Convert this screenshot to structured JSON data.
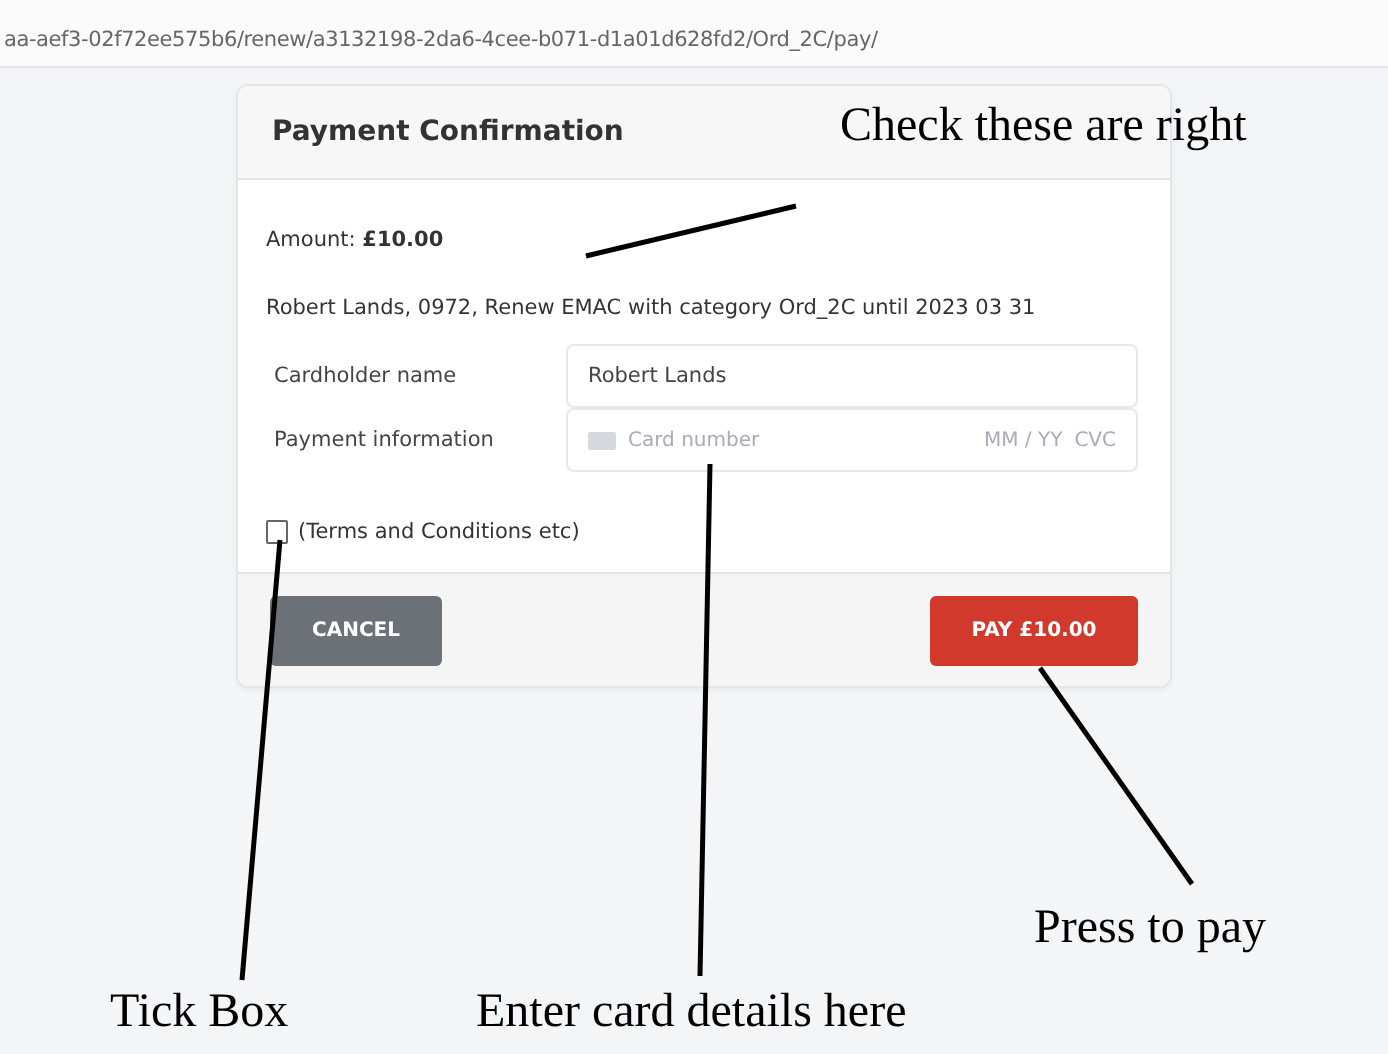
{
  "address_bar": {
    "url": "aa-aef3-02f72ee575b6/renew/a3132198-2da6-4cee-b071-d1a01d628fd2/Ord_2C/pay/"
  },
  "dialog": {
    "title": "Payment Confirmation",
    "amount": "Amount: **£10.00**",
    "description": "Robert Lands, 0972, Renew EMAC with category Ord_2C until 2023 03 31",
    "cardholder": {
      "label": "Cardholder name",
      "value": "Robert Lands"
    },
    "payment": {
      "label": "Payment information",
      "placeholder": "Card number",
      "expiry_placeholder": "MM / YY",
      "cvc_placeholder": "CVC"
    },
    "terms": {
      "label": "(Terms and Conditions etc)",
      "checked": false
    },
    "buttons": [
      {
        "kind": "cancel",
        "label": "CANCEL"
      },
      {
        "kind": "pay",
        "label": "PAY £10.00"
      }
    ]
  },
  "annotations": [
    {
      "text": "Check these are right"
    },
    {
      "text": "Press to pay"
    },
    {
      "text": "Tick Box"
    },
    {
      "text": "Enter card details here"
    }
  ]
}
